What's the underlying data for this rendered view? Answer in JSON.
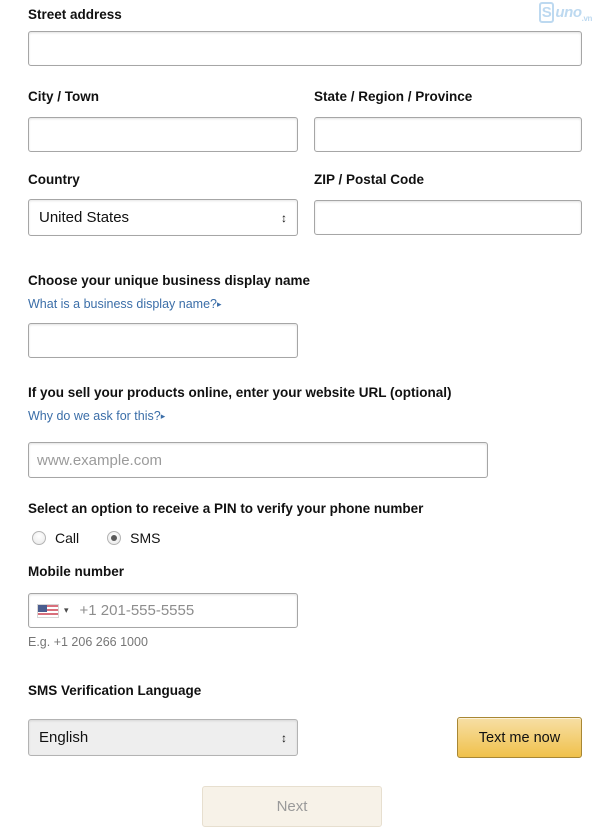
{
  "watermark": {
    "mark": "S",
    "name": "uno",
    "tld": ".vn"
  },
  "address": {
    "street_label": "Street address",
    "street_value": "",
    "city_label": "City / Town",
    "city_value": "",
    "state_label": "State / Region / Province",
    "state_value": "",
    "country_label": "Country",
    "country_value": "United States",
    "zip_label": "ZIP / Postal Code",
    "zip_value": ""
  },
  "display_name": {
    "label": "Choose your unique business display name",
    "link": "What is a business display name?",
    "link_caret": "▸",
    "value": ""
  },
  "website": {
    "label": "If you sell your products online, enter your website URL (optional)",
    "link": "Why do we ask for this?",
    "link_caret": "▸",
    "placeholder": "www.example.com",
    "value": ""
  },
  "pin": {
    "label": "Select an option to receive a PIN to verify your phone number",
    "options": [
      {
        "label": "Call",
        "selected": false
      },
      {
        "label": "SMS",
        "selected": true
      }
    ]
  },
  "mobile": {
    "label": "Mobile number",
    "country_code_flag": "us-flag-icon",
    "caret": "▾",
    "placeholder": "+1 201-555-5555",
    "value": "",
    "hint": "E.g. +1 206 266 1000"
  },
  "sms_language": {
    "label": "SMS Verification Language",
    "value": "English",
    "arrows": "↕"
  },
  "buttons": {
    "text_me_now": "Text me now",
    "next": "Next"
  },
  "select_arrows": "↕",
  "colors": {
    "link": "#3b6ea8",
    "gold_top": "#f7dfa5",
    "gold_bottom": "#f0c14b",
    "gold_border": "#a88734",
    "disabled_bg": "#f7f2e8",
    "disabled_text": "#9a9a9a",
    "watermark": "#bdd9f0"
  }
}
